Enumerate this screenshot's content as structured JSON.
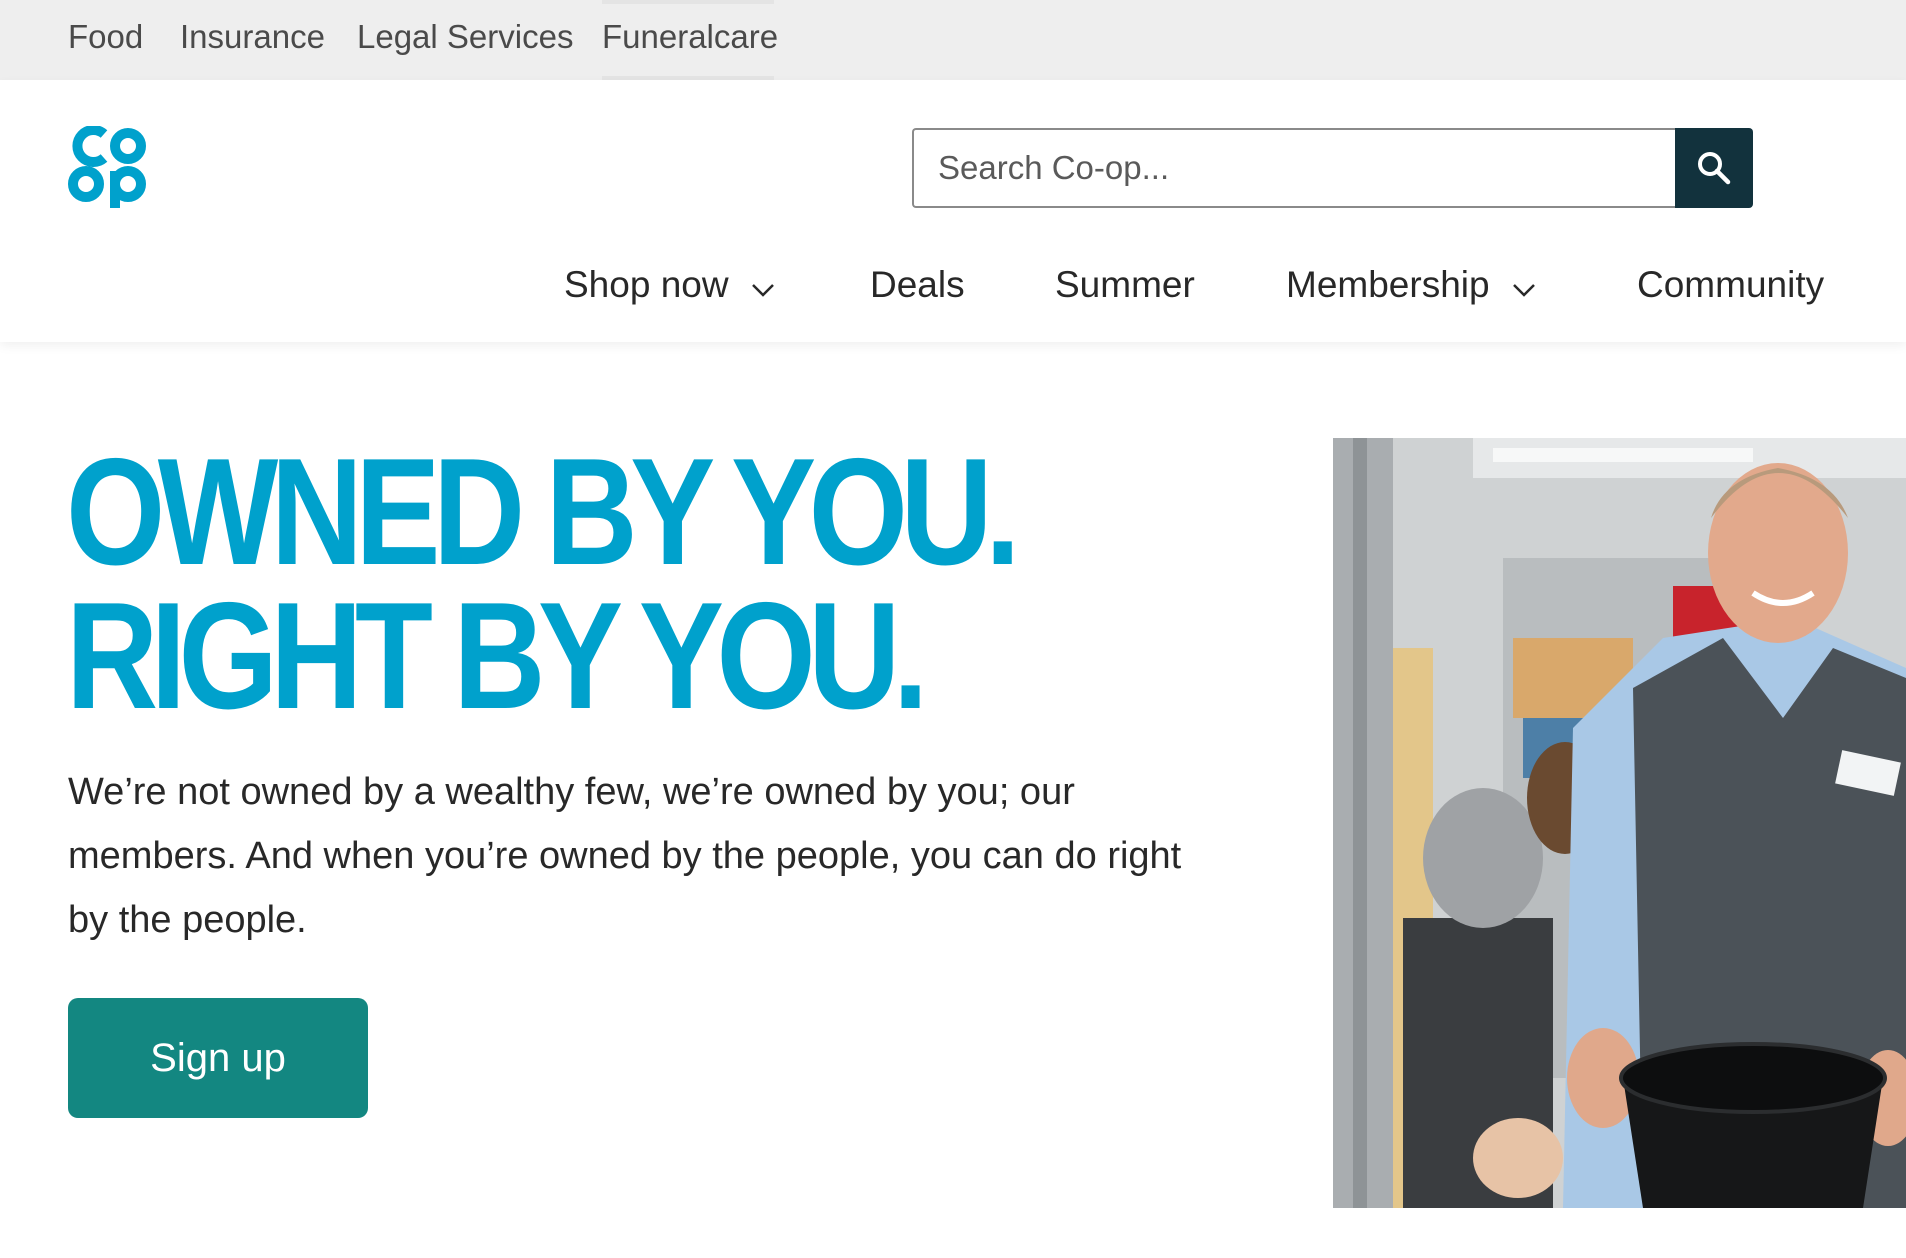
{
  "utility_nav": {
    "items": [
      {
        "label": "Food"
      },
      {
        "label": "Insurance"
      },
      {
        "label": "Legal Services"
      },
      {
        "label": "Funeralcare"
      }
    ]
  },
  "header": {
    "logo_text": "co op",
    "logo_icon": "co-op-logo",
    "search": {
      "placeholder": "Search Co-op...",
      "value": "",
      "button_icon": "search-icon"
    }
  },
  "main_nav": {
    "items": [
      {
        "label": "Shop now",
        "has_dropdown": true
      },
      {
        "label": "Deals",
        "has_dropdown": false
      },
      {
        "label": "Summer",
        "has_dropdown": false
      },
      {
        "label": "Membership",
        "has_dropdown": true
      },
      {
        "label": "Community",
        "has_dropdown": false
      }
    ]
  },
  "hero": {
    "title_line1": "OWNED BY YOU.",
    "title_line2": "RIGHT BY YOU.",
    "body": "We’re not owned by a wealthy few, we’re owned by you; our members. And when you’re owned by the people, you can do right by the people.",
    "cta_label": "Sign up",
    "image_subject": "Smiling Co-op store colleague holding a black bucket"
  },
  "colors": {
    "brand_blue": "#00a1cc",
    "cta_teal": "#138781",
    "search_button": "#12323d",
    "utility_bar_bg": "#eeeeee",
    "text": "#282828"
  }
}
